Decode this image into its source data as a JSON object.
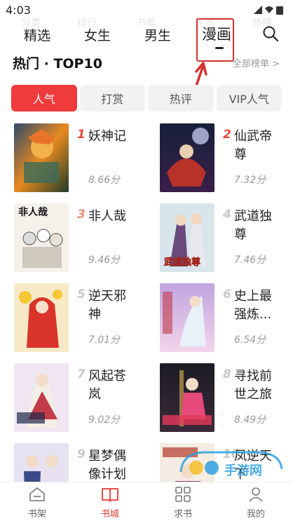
{
  "status": {
    "time": "4:03"
  },
  "ghost_labels": [
    "分类",
    "排行",
    "书单",
    "完本",
    "热搜"
  ],
  "tabs": [
    {
      "label": "精选"
    },
    {
      "label": "女生"
    },
    {
      "label": "男生"
    },
    {
      "label": "漫画"
    }
  ],
  "active_tab": "漫画",
  "section": {
    "title": "热门 · TOP10",
    "more": "全部榜单 >"
  },
  "segments": [
    {
      "label": "人气",
      "active": true
    },
    {
      "label": "打赏",
      "active": false
    },
    {
      "label": "热评",
      "active": false
    },
    {
      "label": "VIP人气",
      "active": false
    }
  ],
  "items": [
    {
      "rank": "1",
      "title": "妖神记",
      "score": "8.66分"
    },
    {
      "rank": "2",
      "title": "仙武帝尊",
      "score": "7.32分"
    },
    {
      "rank": "3",
      "title": "非人哉",
      "score": "9.46分",
      "cover_text": "非人哉"
    },
    {
      "rank": "4",
      "title": "武道独尊",
      "score": "7.46分",
      "cover_text": "武道独尊"
    },
    {
      "rank": "5",
      "title": "逆天邪神",
      "score": "7.01分"
    },
    {
      "rank": "6",
      "title": "史上最强炼...",
      "score": "6.54分"
    },
    {
      "rank": "7",
      "title": "风起苍岚",
      "score": "9.02分"
    },
    {
      "rank": "8",
      "title": "寻找前世之旅",
      "score": "8.49分"
    },
    {
      "rank": "9",
      "title": "星梦偶像计划",
      "score": ""
    },
    {
      "rank": "10",
      "title": "凤逆天下",
      "score": ""
    }
  ],
  "colors": {
    "accent": "#ef3b3b",
    "rank_top": "#e24a3b",
    "rank_other": "#c8c8c8"
  },
  "bottom_nav": [
    {
      "label": "书架",
      "icon": "bookshelf-icon"
    },
    {
      "label": "书城",
      "icon": "open-book-icon",
      "active": true
    },
    {
      "label": "求书",
      "icon": "grid-icon"
    },
    {
      "label": "我的",
      "icon": "profile-icon"
    }
  ],
  "watermark": {
    "text": "手游网"
  }
}
